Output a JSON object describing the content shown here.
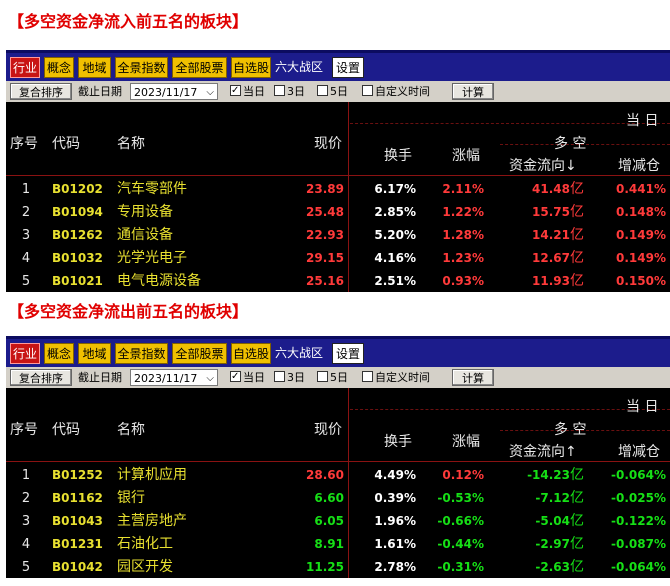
{
  "sections": [
    {
      "title": "【多空资金净流入前五名的板块】",
      "toolbar": {
        "tabs": [
          "行业",
          "概念",
          "地域",
          "全景指数",
          "全部股票",
          "自选股"
        ],
        "region_label": "六大战区",
        "settings_label": "设置"
      },
      "filters": {
        "sort_button": "复合排序",
        "date_label": "截止日期",
        "date_value": "2023/11/17",
        "options": [
          {
            "label": "当日",
            "checked": true
          },
          {
            "label": "3日",
            "checked": false
          },
          {
            "label": "5日",
            "checked": false
          },
          {
            "label": "自定义时间",
            "checked": false
          }
        ],
        "calc_button": "计算"
      },
      "headers": {
        "no": "序号",
        "code": "代码",
        "name": "名称",
        "price": "现价",
        "turnover": "换手",
        "change": "涨幅",
        "group": "多 空",
        "flow": "资金流向↓",
        "delta": "增减仓",
        "top_right": "当 日"
      },
      "rows": [
        {
          "no": "1",
          "code": "B01202",
          "name": "汽车零部件",
          "price": "23.89",
          "turnover": "6.17%",
          "change": "2.11%",
          "flow": "41.48",
          "flow_unit": "亿",
          "delta": "0.441%"
        },
        {
          "no": "2",
          "code": "B01094",
          "name": "专用设备",
          "price": "25.48",
          "turnover": "2.85%",
          "change": "1.22%",
          "flow": "15.75",
          "flow_unit": "亿",
          "delta": "0.148%"
        },
        {
          "no": "3",
          "code": "B01262",
          "name": "通信设备",
          "price": "22.93",
          "turnover": "5.20%",
          "change": "1.28%",
          "flow": "14.21",
          "flow_unit": "亿",
          "delta": "0.149%"
        },
        {
          "no": "4",
          "code": "B01032",
          "name": "光学光电子",
          "price": "29.15",
          "turnover": "4.16%",
          "change": "1.23%",
          "flow": "12.67",
          "flow_unit": "亿",
          "delta": "0.149%"
        },
        {
          "no": "5",
          "code": "B01021",
          "name": "电气电源设备",
          "price": "25.16",
          "turnover": "2.51%",
          "change": "0.93%",
          "flow": "11.93",
          "flow_unit": "亿",
          "delta": "0.150%"
        }
      ]
    },
    {
      "title": "【多空资金净流出前五名的板块】",
      "toolbar": {
        "tabs": [
          "行业",
          "概念",
          "地域",
          "全景指数",
          "全部股票",
          "自选股"
        ],
        "region_label": "六大战区",
        "settings_label": "设置"
      },
      "filters": {
        "sort_button": "复合排序",
        "date_label": "截止日期",
        "date_value": "2023/11/17",
        "options": [
          {
            "label": "当日",
            "checked": true
          },
          {
            "label": "3日",
            "checked": false
          },
          {
            "label": "5日",
            "checked": false
          },
          {
            "label": "自定义时间",
            "checked": false
          }
        ],
        "calc_button": "计算"
      },
      "headers": {
        "no": "序号",
        "code": "代码",
        "name": "名称",
        "price": "现价",
        "turnover": "换手",
        "change": "涨幅",
        "group": "多 空",
        "flow": "资金流向↑",
        "delta": "增减仓",
        "top_right": "当 日"
      },
      "rows": [
        {
          "no": "1",
          "code": "B01252",
          "name": "计算机应用",
          "price": "28.60",
          "turnover": "4.49%",
          "change": "0.12%",
          "flow": "-14.23",
          "flow_unit": "亿",
          "delta": "-0.064%"
        },
        {
          "no": "2",
          "code": "B01162",
          "name": "银行",
          "price": "6.60",
          "turnover": "0.39%",
          "change": "-0.53%",
          "flow": "-7.12",
          "flow_unit": "亿",
          "delta": "-0.025%"
        },
        {
          "no": "3",
          "code": "B01043",
          "name": "主营房地产",
          "price": "6.05",
          "turnover": "1.96%",
          "change": "-0.66%",
          "flow": "-5.04",
          "flow_unit": "亿",
          "delta": "-0.122%"
        },
        {
          "no": "4",
          "code": "B01231",
          "name": "石油化工",
          "price": "8.91",
          "turnover": "1.61%",
          "change": "-0.44%",
          "flow": "-2.97",
          "flow_unit": "亿",
          "delta": "-0.087%"
        },
        {
          "no": "5",
          "code": "B01042",
          "name": "园区开发",
          "price": "11.25",
          "turnover": "2.78%",
          "change": "-0.31%",
          "flow": "-2.63",
          "flow_unit": "亿",
          "delta": "-0.064%"
        }
      ]
    }
  ]
}
